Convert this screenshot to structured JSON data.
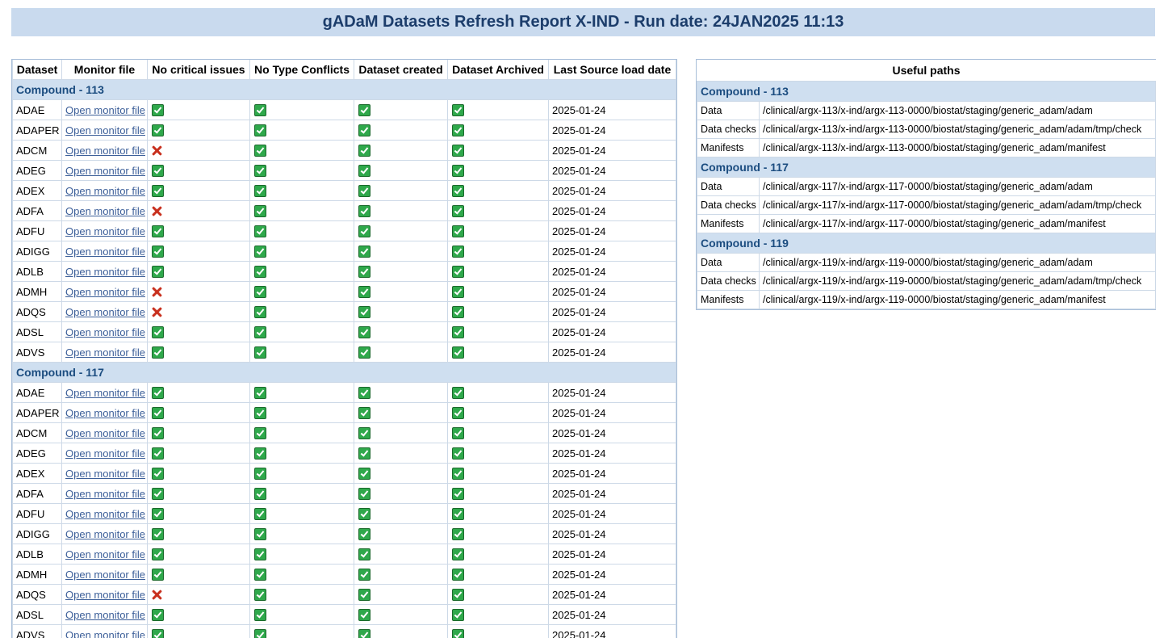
{
  "report": {
    "title": "gADaM Datasets Refresh Report X-IND - Run date: 24JAN2025 11:13"
  },
  "datasets_table": {
    "headers": [
      "Dataset",
      "Monitor file",
      "No critical issues",
      "No Type Conflicts",
      "Dataset created",
      "Dataset Archived",
      "Last Source load date"
    ],
    "link_label": "Open monitor file",
    "groups": [
      {
        "name": "Compound - 113",
        "rows": [
          {
            "dataset": "ADAE",
            "critical": "ok",
            "conflicts": "ok",
            "created": "ok",
            "archived": "ok",
            "date": "2025-01-24"
          },
          {
            "dataset": "ADAPER",
            "critical": "ok",
            "conflicts": "ok",
            "created": "ok",
            "archived": "ok",
            "date": "2025-01-24"
          },
          {
            "dataset": "ADCM",
            "critical": "fail",
            "conflicts": "ok",
            "created": "ok",
            "archived": "ok",
            "date": "2025-01-24"
          },
          {
            "dataset": "ADEG",
            "critical": "ok",
            "conflicts": "ok",
            "created": "ok",
            "archived": "ok",
            "date": "2025-01-24"
          },
          {
            "dataset": "ADEX",
            "critical": "ok",
            "conflicts": "ok",
            "created": "ok",
            "archived": "ok",
            "date": "2025-01-24"
          },
          {
            "dataset": "ADFA",
            "critical": "fail",
            "conflicts": "ok",
            "created": "ok",
            "archived": "ok",
            "date": "2025-01-24"
          },
          {
            "dataset": "ADFU",
            "critical": "ok",
            "conflicts": "ok",
            "created": "ok",
            "archived": "ok",
            "date": "2025-01-24"
          },
          {
            "dataset": "ADIGG",
            "critical": "ok",
            "conflicts": "ok",
            "created": "ok",
            "archived": "ok",
            "date": "2025-01-24"
          },
          {
            "dataset": "ADLB",
            "critical": "ok",
            "conflicts": "ok",
            "created": "ok",
            "archived": "ok",
            "date": "2025-01-24"
          },
          {
            "dataset": "ADMH",
            "critical": "fail",
            "conflicts": "ok",
            "created": "ok",
            "archived": "ok",
            "date": "2025-01-24"
          },
          {
            "dataset": "ADQS",
            "critical": "fail",
            "conflicts": "ok",
            "created": "ok",
            "archived": "ok",
            "date": "2025-01-24"
          },
          {
            "dataset": "ADSL",
            "critical": "ok",
            "conflicts": "ok",
            "created": "ok",
            "archived": "ok",
            "date": "2025-01-24"
          },
          {
            "dataset": "ADVS",
            "critical": "ok",
            "conflicts": "ok",
            "created": "ok",
            "archived": "ok",
            "date": "2025-01-24"
          }
        ]
      },
      {
        "name": "Compound - 117",
        "rows": [
          {
            "dataset": "ADAE",
            "critical": "ok",
            "conflicts": "ok",
            "created": "ok",
            "archived": "ok",
            "date": "2025-01-24"
          },
          {
            "dataset": "ADAPER",
            "critical": "ok",
            "conflicts": "ok",
            "created": "ok",
            "archived": "ok",
            "date": "2025-01-24"
          },
          {
            "dataset": "ADCM",
            "critical": "ok",
            "conflicts": "ok",
            "created": "ok",
            "archived": "ok",
            "date": "2025-01-24"
          },
          {
            "dataset": "ADEG",
            "critical": "ok",
            "conflicts": "ok",
            "created": "ok",
            "archived": "ok",
            "date": "2025-01-24"
          },
          {
            "dataset": "ADEX",
            "critical": "ok",
            "conflicts": "ok",
            "created": "ok",
            "archived": "ok",
            "date": "2025-01-24"
          },
          {
            "dataset": "ADFA",
            "critical": "ok",
            "conflicts": "ok",
            "created": "ok",
            "archived": "ok",
            "date": "2025-01-24"
          },
          {
            "dataset": "ADFU",
            "critical": "ok",
            "conflicts": "ok",
            "created": "ok",
            "archived": "ok",
            "date": "2025-01-24"
          },
          {
            "dataset": "ADIGG",
            "critical": "ok",
            "conflicts": "ok",
            "created": "ok",
            "archived": "ok",
            "date": "2025-01-24"
          },
          {
            "dataset": "ADLB",
            "critical": "ok",
            "conflicts": "ok",
            "created": "ok",
            "archived": "ok",
            "date": "2025-01-24"
          },
          {
            "dataset": "ADMH",
            "critical": "ok",
            "conflicts": "ok",
            "created": "ok",
            "archived": "ok",
            "date": "2025-01-24"
          },
          {
            "dataset": "ADQS",
            "critical": "fail",
            "conflicts": "ok",
            "created": "ok",
            "archived": "ok",
            "date": "2025-01-24"
          },
          {
            "dataset": "ADSL",
            "critical": "ok",
            "conflicts": "ok",
            "created": "ok",
            "archived": "ok",
            "date": "2025-01-24"
          },
          {
            "dataset": "ADVS",
            "critical": "ok",
            "conflicts": "ok",
            "created": "ok",
            "archived": "ok",
            "date": "2025-01-24"
          }
        ]
      }
    ]
  },
  "paths_table": {
    "header": "Useful paths",
    "groups": [
      {
        "name": "Compound - 113",
        "rows": [
          {
            "label": "Data",
            "path": "/clinical/argx-113/x-ind/argx-113-0000/biostat/staging/generic_adam/adam"
          },
          {
            "label": "Data checks",
            "path": "/clinical/argx-113/x-ind/argx-113-0000/biostat/staging/generic_adam/adam/tmp/check"
          },
          {
            "label": "Manifests",
            "path": "/clinical/argx-113/x-ind/argx-113-0000/biostat/staging/generic_adam/manifest"
          }
        ]
      },
      {
        "name": "Compound - 117",
        "rows": [
          {
            "label": "Data",
            "path": "/clinical/argx-117/x-ind/argx-117-0000/biostat/staging/generic_adam/adam"
          },
          {
            "label": "Data checks",
            "path": "/clinical/argx-117/x-ind/argx-117-0000/biostat/staging/generic_adam/adam/tmp/check"
          },
          {
            "label": "Manifests",
            "path": "/clinical/argx-117/x-ind/argx-117-0000/biostat/staging/generic_adam/manifest"
          }
        ]
      },
      {
        "name": "Compound - 119",
        "rows": [
          {
            "label": "Data",
            "path": "/clinical/argx-119/x-ind/argx-119-0000/biostat/staging/generic_adam/adam"
          },
          {
            "label": "Data checks",
            "path": "/clinical/argx-119/x-ind/argx-119-0000/biostat/staging/generic_adam/adam/tmp/check"
          },
          {
            "label": "Manifests",
            "path": "/clinical/argx-119/x-ind/argx-119-0000/biostat/staging/generic_adam/manifest"
          }
        ]
      }
    ]
  },
  "icons": {
    "ok": "green-checkbox-icon",
    "fail": "red-x-icon"
  },
  "colors": {
    "title_bg": "#c9daee",
    "title_text": "#1c3d6b",
    "group_bg": "#cfdff0",
    "group_text": "#1c4d80",
    "link": "#3c5f99",
    "ok": "#2fa84b",
    "fail": "#c8301e"
  }
}
